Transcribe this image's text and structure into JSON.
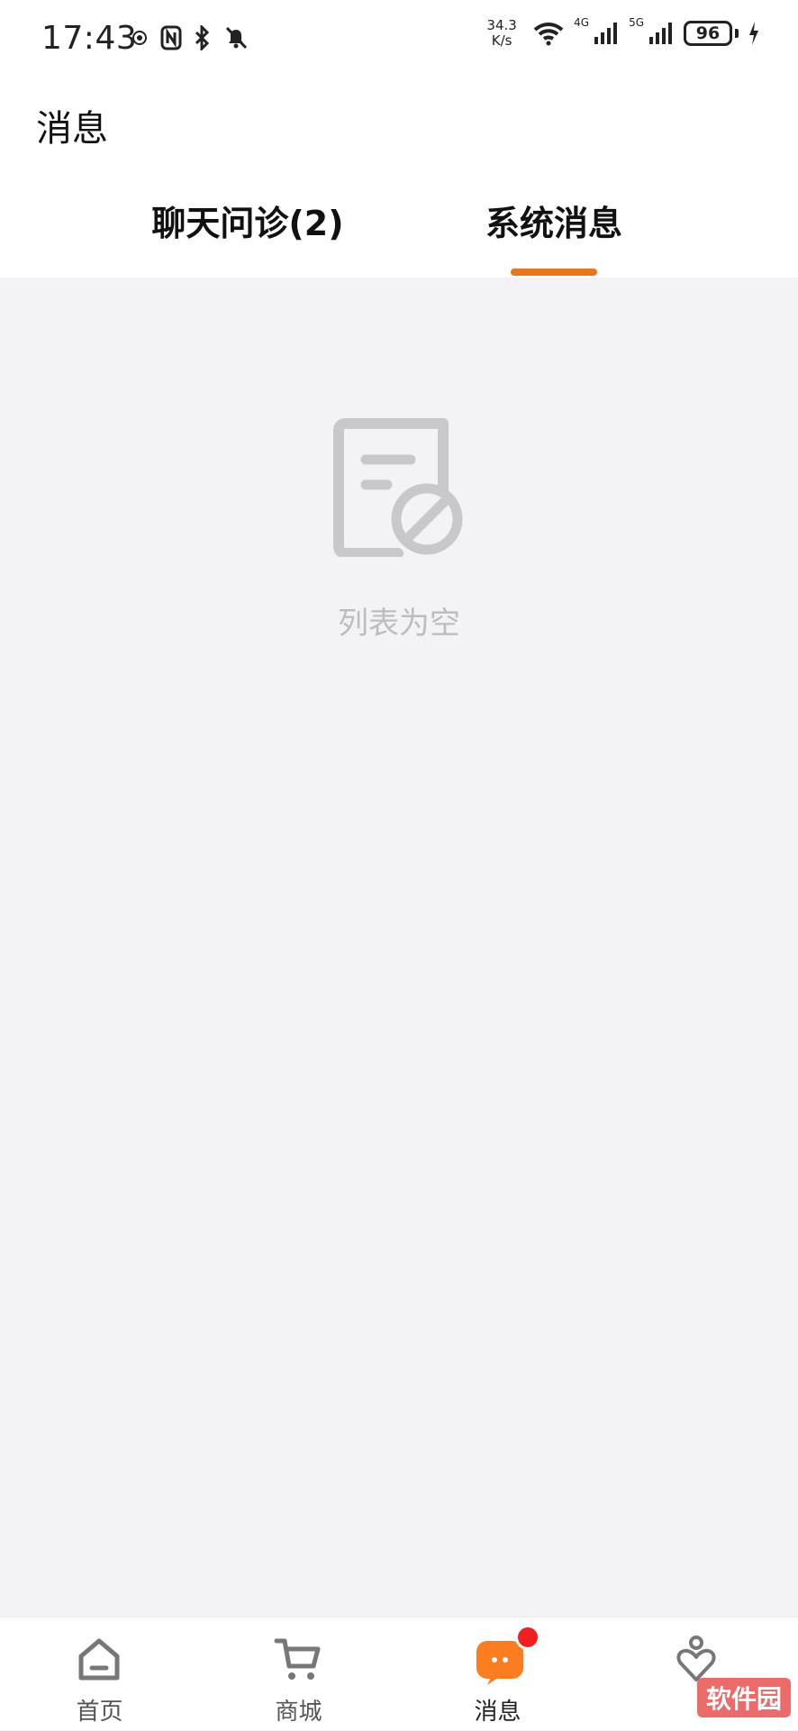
{
  "status_bar": {
    "time": "17:43",
    "left_icons": [
      "location-status-icon",
      "nfc-icon",
      "bluetooth-icon",
      "notification-off-icon"
    ],
    "net_speed_value": "34.3",
    "net_speed_unit": "K/s",
    "network_4g": "4G",
    "network_5g": "5G",
    "battery": "96"
  },
  "header": {
    "title": "消息"
  },
  "tabs": [
    {
      "label": "聊天问诊(2)",
      "active": false
    },
    {
      "label": "系统消息",
      "active": true
    }
  ],
  "empty_state": {
    "icon": "empty-list-icon",
    "text": "列表为空"
  },
  "bottom_nav": [
    {
      "label": "首页",
      "icon": "home-icon",
      "active": false
    },
    {
      "label": "商城",
      "icon": "cart-icon",
      "active": false
    },
    {
      "label": "消息",
      "icon": "message-icon",
      "active": true,
      "badge": true
    },
    {
      "label": "",
      "icon": "profile-icon",
      "active": false
    }
  ],
  "watermark": "软件园",
  "colors": {
    "accent": "#e8761c",
    "badge": "#f02020",
    "background": "#f3f3f5",
    "empty_icon": "#c8c8cc"
  }
}
